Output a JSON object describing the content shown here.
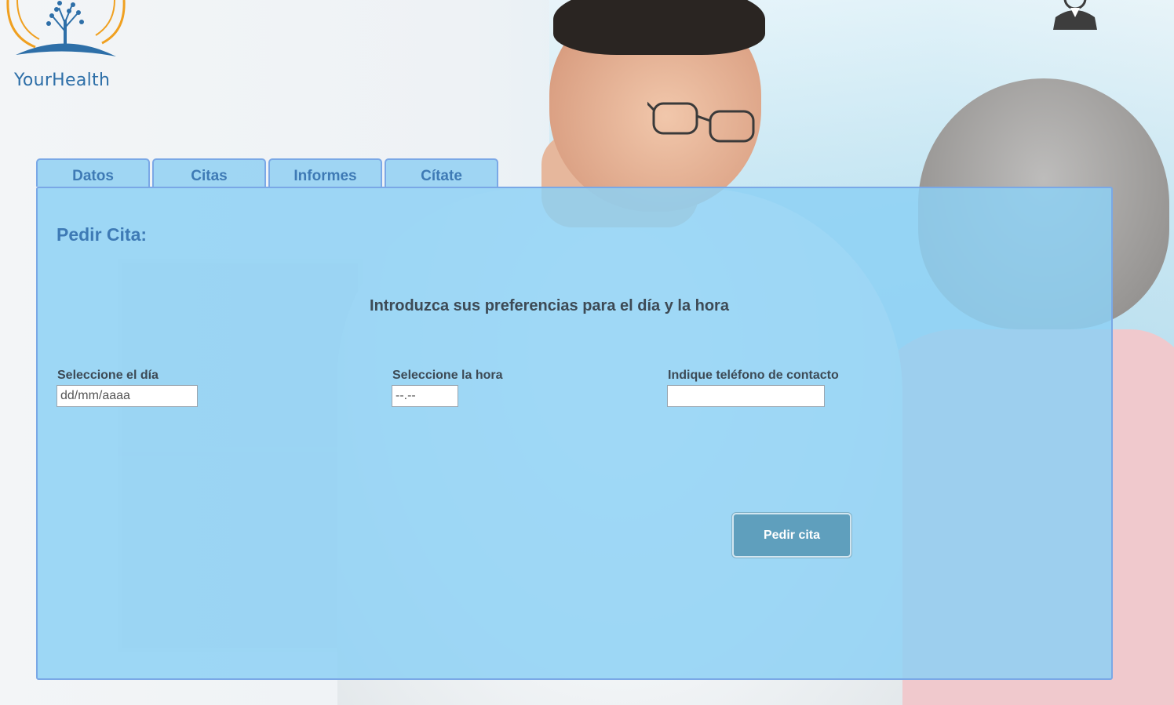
{
  "brand": {
    "name": "YourHealth",
    "logo_icon": "tree-logo-icon",
    "colors": {
      "primary": "#2e6fa8",
      "accent": "#f0a020"
    }
  },
  "header": {
    "user_icon": "user-avatar-icon"
  },
  "tabs": [
    {
      "label": "Datos"
    },
    {
      "label": "Citas"
    },
    {
      "label": "Informes"
    },
    {
      "label": "Cítate"
    }
  ],
  "panel": {
    "title": "Pedir Cita:",
    "instructions": "Introduzca sus preferencias para el día y la hora",
    "fields": {
      "date": {
        "label": "Seleccione el día",
        "placeholder": "dd/mm/aaaa",
        "value": ""
      },
      "time": {
        "label": "Seleccione la hora",
        "placeholder": "--.--",
        "value": ""
      },
      "phone": {
        "label": "Indique teléfono de contacto",
        "placeholder": "",
        "value": ""
      }
    },
    "submit_label": "Pedir cita"
  }
}
